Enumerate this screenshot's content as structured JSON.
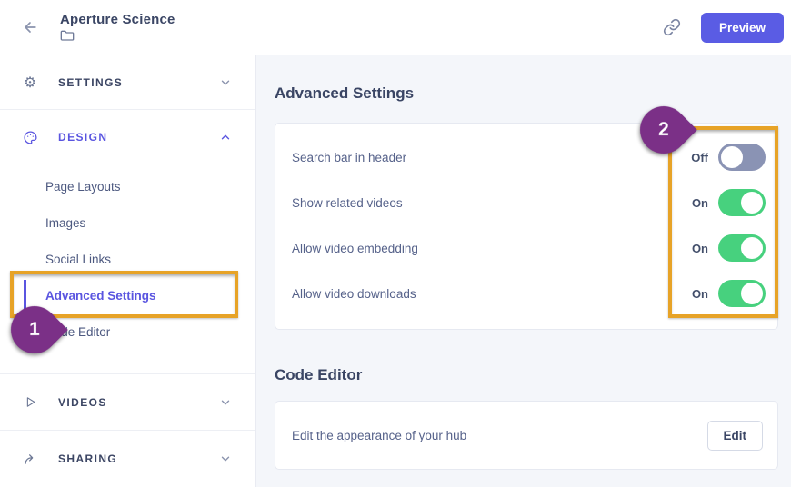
{
  "header": {
    "title": "Aperture Science",
    "preview_label": "Preview",
    "icons": [
      "back-arrow-icon",
      "folder-icon",
      "link-icon"
    ]
  },
  "sidebar": {
    "sections": [
      {
        "label": "SETTINGS",
        "icon": "gear-icon",
        "state": "collapsed"
      },
      {
        "label": "DESIGN",
        "icon": "palette-icon",
        "state": "expanded",
        "active": true,
        "items": [
          {
            "label": "Page Layouts"
          },
          {
            "label": "Images"
          },
          {
            "label": "Social Links"
          },
          {
            "label": "Advanced Settings",
            "active": true
          },
          {
            "label": "Code Editor"
          }
        ]
      },
      {
        "label": "VIDEOS",
        "icon": "play-icon",
        "state": "collapsed"
      },
      {
        "label": "SHARING",
        "icon": "share-icon",
        "state": "collapsed"
      }
    ]
  },
  "main": {
    "advanced_settings": {
      "heading": "Advanced Settings",
      "rows": [
        {
          "label": "Search bar in header",
          "state": "Off",
          "enabled": false
        },
        {
          "label": "Show related videos",
          "state": "On",
          "enabled": true
        },
        {
          "label": "Allow video embedding",
          "state": "On",
          "enabled": true
        },
        {
          "label": "Allow video downloads",
          "state": "On",
          "enabled": true
        }
      ]
    },
    "code_editor": {
      "heading": "Code Editor",
      "row_label": "Edit the appearance of your hub",
      "button_label": "Edit"
    }
  },
  "annotations": {
    "badge_1": "1",
    "badge_2": "2",
    "highlight_color": "#e7a327",
    "badge_color": "#7b3087"
  },
  "colors": {
    "brand_purple": "#5a55e0",
    "button_purple": "#5a5ce4",
    "toggle_on_green": "#47d17e",
    "toggle_off_gray": "#8a93b4",
    "text_dark": "#3b4665",
    "content_bg": "#f4f6fa"
  }
}
